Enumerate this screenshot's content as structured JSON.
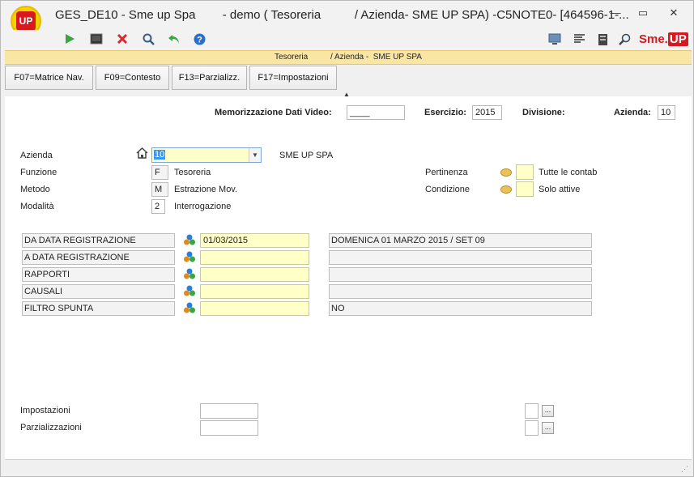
{
  "window": {
    "title": "GES_DE10 - Sme up Spa        - demo ( Tesoreria          / Azienda- SME UP SPA) -C5NOTE0- [464596-1-...",
    "logo_text": "UP",
    "controls": {
      "minimize": "—",
      "restore": "▭",
      "close": "✕"
    }
  },
  "toolbar": {
    "icons": [
      "run-icon",
      "console-icon",
      "cancel-icon",
      "search-icon",
      "undo-icon",
      "help-icon"
    ],
    "right_icons": [
      "monitor-icon",
      "list-icon",
      "document-icon",
      "magnifier-icon"
    ],
    "brand_sme": "Sme.",
    "brand_up": "UP"
  },
  "header": {
    "strip_text": "Tesoreria          / Azienda -  SME UP SPA"
  },
  "function_keys": [
    {
      "label": "F07=Matrice Nav."
    },
    {
      "label": "F09=Contesto"
    },
    {
      "label": "F13=Parzializz."
    },
    {
      "label": "F17=Impostazioni"
    }
  ],
  "top_fields": {
    "memo_label": "Memorizzazione Dati Video:",
    "memo_value": "____",
    "esercizio_label": "Esercizio:",
    "esercizio_value": "2015",
    "divisione_label": "Divisione:",
    "azienda_label": "Azienda:",
    "azienda_value": "10"
  },
  "form": {
    "azienda_label": "Azienda",
    "azienda_value": "10",
    "azienda_desc": "SME UP SPA",
    "funzione_label": "Funzione",
    "funzione_value": "F",
    "funzione_desc": "Tesoreria",
    "metodo_label": "Metodo",
    "metodo_value": "M",
    "metodo_desc": "Estrazione Mov.",
    "modalita_label": "Modalità",
    "modalita_value": "2",
    "modalita_desc": "Interrogazione",
    "pertinenza_label": "Pertinenza",
    "pertinenza_desc": "Tutte le contab",
    "condizione_label": "Condizione",
    "condizione_desc": "Solo attive"
  },
  "filters": [
    {
      "label": "DA DATA REGISTRAZIONE",
      "value": "01/03/2015",
      "desc": "DOMENICA 01 MARZO 2015 / SET 09"
    },
    {
      "label": "A  DATA REGISTRAZIONE",
      "value": "",
      "desc": ""
    },
    {
      "label": "RAPPORTI",
      "value": "",
      "desc": ""
    },
    {
      "label": "CAUSALI",
      "value": "",
      "desc": ""
    },
    {
      "label": "FILTRO SPUNTA",
      "value": "",
      "desc": "NO"
    }
  ],
  "bottom": {
    "impostazioni_label": "Impostazioni",
    "parzializzazioni_label": "Parzializzazioni",
    "ellipsis": "..."
  },
  "colors": {
    "strip_bg": "#f9e6a4",
    "input_yellow": "#ffffc8",
    "brand_red": "#d71920",
    "logo_yellow": "#f4d200"
  }
}
